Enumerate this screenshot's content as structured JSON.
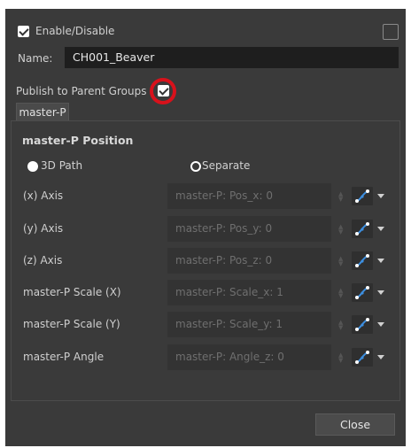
{
  "header": {
    "enable_label": "Enable/Disable",
    "enable_checked": true,
    "corner_checkbox_checked": false
  },
  "name": {
    "label": "Name:",
    "value": "CH001_Beaver"
  },
  "publish": {
    "label": "Publish to Parent Groups",
    "checked": true
  },
  "tab": {
    "label": "master-P"
  },
  "group": {
    "title": "master-P Position",
    "radio_3d_path": "3D Path",
    "radio_separate": "Separate",
    "selected_mode": "3D Path"
  },
  "rows": [
    {
      "label": "(x) Axis",
      "value": "master-P: Pos_x: 0"
    },
    {
      "label": "(y) Axis",
      "value": "master-P: Pos_y: 0"
    },
    {
      "label": "(z) Axis",
      "value": "master-P: Pos_z: 0"
    },
    {
      "label": "master-P Scale (X)",
      "value": "master-P: Scale_x: 1"
    },
    {
      "label": "master-P Scale (Y)",
      "value": "master-P: Scale_y: 1"
    },
    {
      "label": "master-P Angle",
      "value": "master-P: Angle_z: 0"
    }
  ],
  "footer": {
    "close_label": "Close"
  },
  "colors": {
    "dialog_bg": "#3a3a3a",
    "highlight_ring": "#d8111b",
    "function_icon_blue": "#3d8fe0"
  },
  "icons": {
    "function_button": "function-curve-icon",
    "dropdown": "chevron-down-icon"
  }
}
